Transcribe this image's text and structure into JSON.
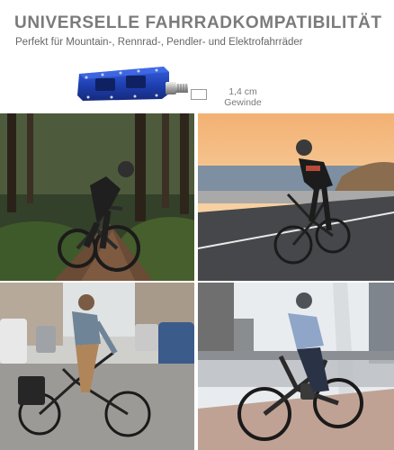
{
  "header": {
    "title": "UNIVERSELLE FAHRRADKOMPATIBILITÄT",
    "subtitle": "Perfekt für Mountain-, Rennrad-, Pendler- und Elektrofahrräder"
  },
  "product": {
    "icon": "bike-pedal-icon",
    "pedal_color": "#1f3fb0",
    "thread_size": "1,4 cm",
    "thread_label": "Gewinde"
  }
}
